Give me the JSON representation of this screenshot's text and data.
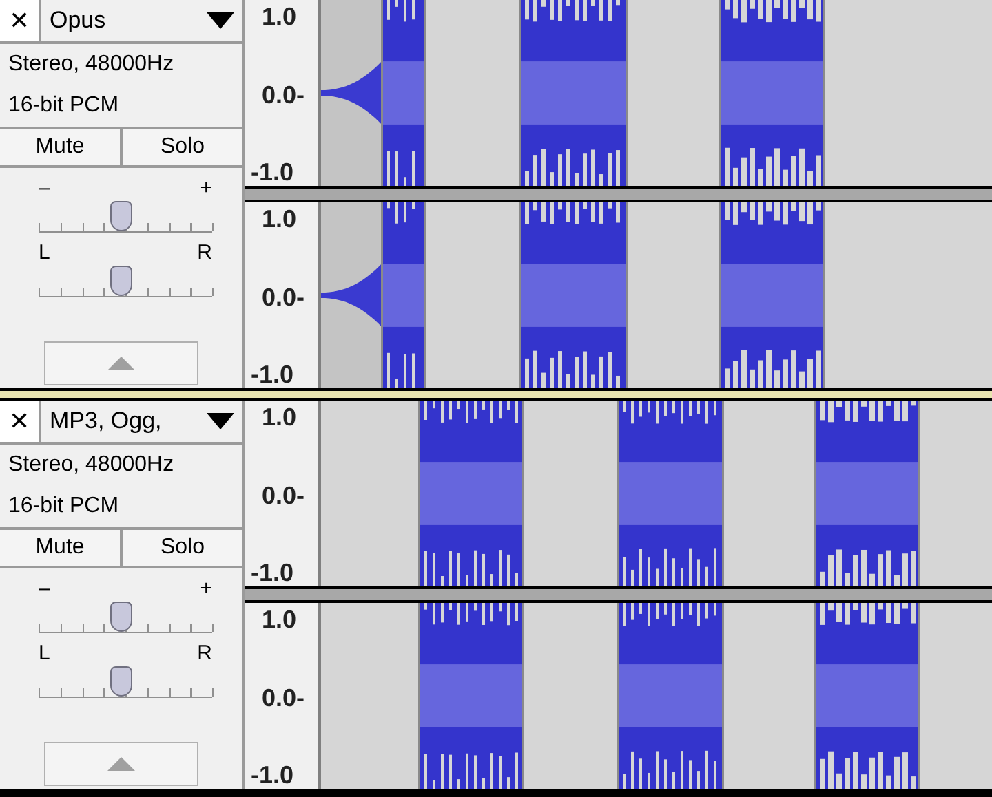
{
  "tracks": [
    {
      "close": "✕",
      "name": "Opus",
      "format": "Stereo, 48000Hz",
      "bits": "16-bit PCM",
      "buttons": [
        "Mute",
        "Solo"
      ],
      "gain": {
        "minus": "–",
        "plus": "+",
        "level": 0.48
      },
      "pan": {
        "left": "L",
        "right": "R",
        "level": 0.48
      },
      "channels": [
        {
          "axis": [
            "1.0",
            "0.0-",
            "-1.0"
          ]
        },
        {
          "axis": [
            "1.0",
            "0.0-",
            "-1.0"
          ]
        }
      ]
    },
    {
      "close": "✕",
      "name": "MP3, Ogg,",
      "format": "Stereo, 48000Hz",
      "bits": "16-bit PCM",
      "buttons": [
        "Mute",
        "Solo"
      ],
      "gain": {
        "minus": "–",
        "plus": "+",
        "level": 0.48
      },
      "pan": {
        "left": "L",
        "right": "R",
        "level": 0.48
      },
      "channels": [
        {
          "axis": [
            "1.0",
            "0.0-",
            "-1.0"
          ]
        },
        {
          "axis": [
            "1.0",
            "0.0-",
            "-1.0"
          ]
        }
      ]
    }
  ]
}
